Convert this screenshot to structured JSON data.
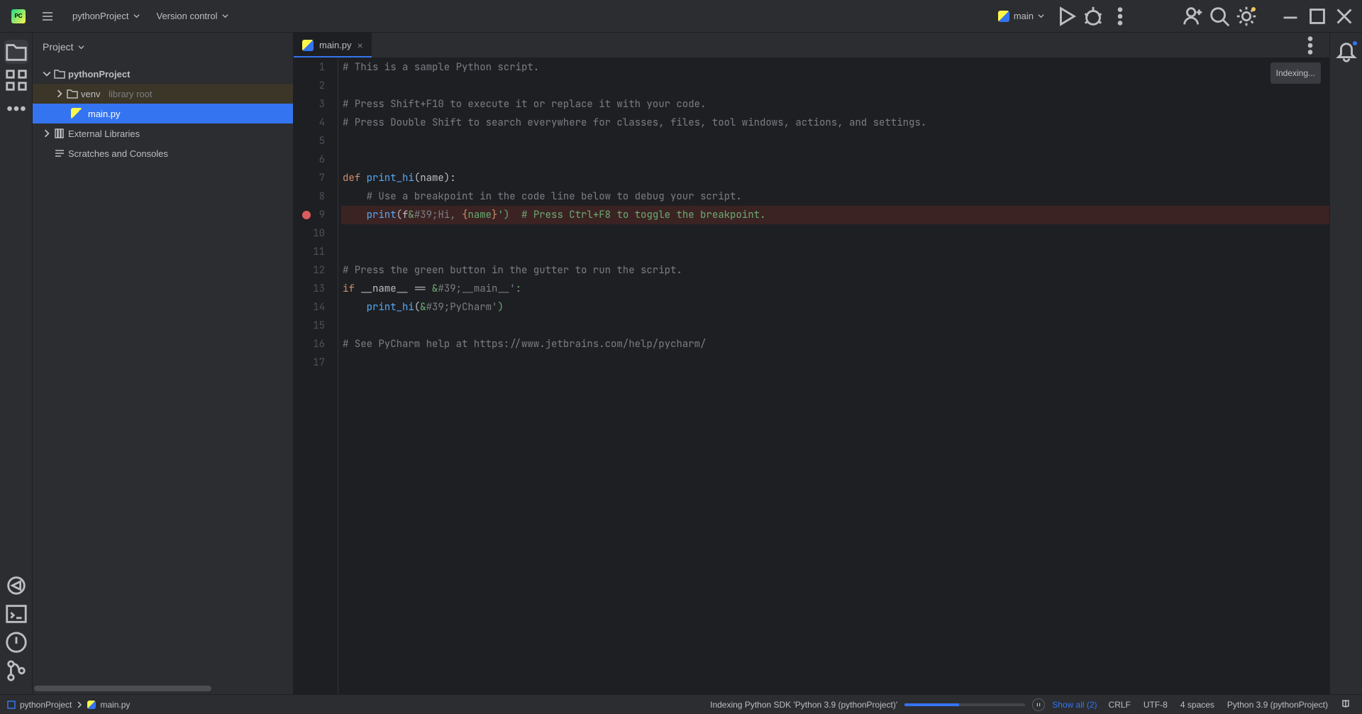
{
  "top": {
    "project_name": "pythonProject",
    "vcs_label": "Version control",
    "run_config": "main"
  },
  "panel": {
    "title": "Project"
  },
  "tree": {
    "root": "pythonProject",
    "venv": "venv",
    "venv_hint": "library root",
    "file1": "main.py",
    "ext_libs": "External Libraries",
    "scratches": "Scratches and Consoles"
  },
  "tab": {
    "label": "main.py",
    "indexing": "Indexing..."
  },
  "code": {
    "lines": [
      "# This is a sample Python script.",
      "",
      "# Press Shift+F10 to execute it or replace it with your code.",
      "# Press Double Shift to search everywhere for classes, files, tool windows, actions, and settings.",
      "",
      "",
      "def print_hi(name):",
      "    # Use a breakpoint in the code line below to debug your script.",
      "    print(f'Hi, {name}')  # Press Ctrl+F8 to toggle the breakpoint.",
      "",
      "",
      "# Press the green button in the gutter to run the script.",
      "if __name__ == '__main__':",
      "    print_hi('PyCharm')",
      "",
      "# See PyCharm help at https://www.jetbrains.com/help/pycharm/",
      ""
    ],
    "breakpoint_line": 9,
    "total_lines": 17
  },
  "status": {
    "breadcrumb_root": "pythonProject",
    "breadcrumb_file": "main.py",
    "indexing_text": "Indexing Python SDK 'Python 3.9 (pythonProject)'",
    "show_all": "Show all (2)",
    "eol": "CRLF",
    "encoding": "UTF-8",
    "indent": "4 spaces",
    "interpreter": "Python 3.9 (pythonProject)"
  }
}
